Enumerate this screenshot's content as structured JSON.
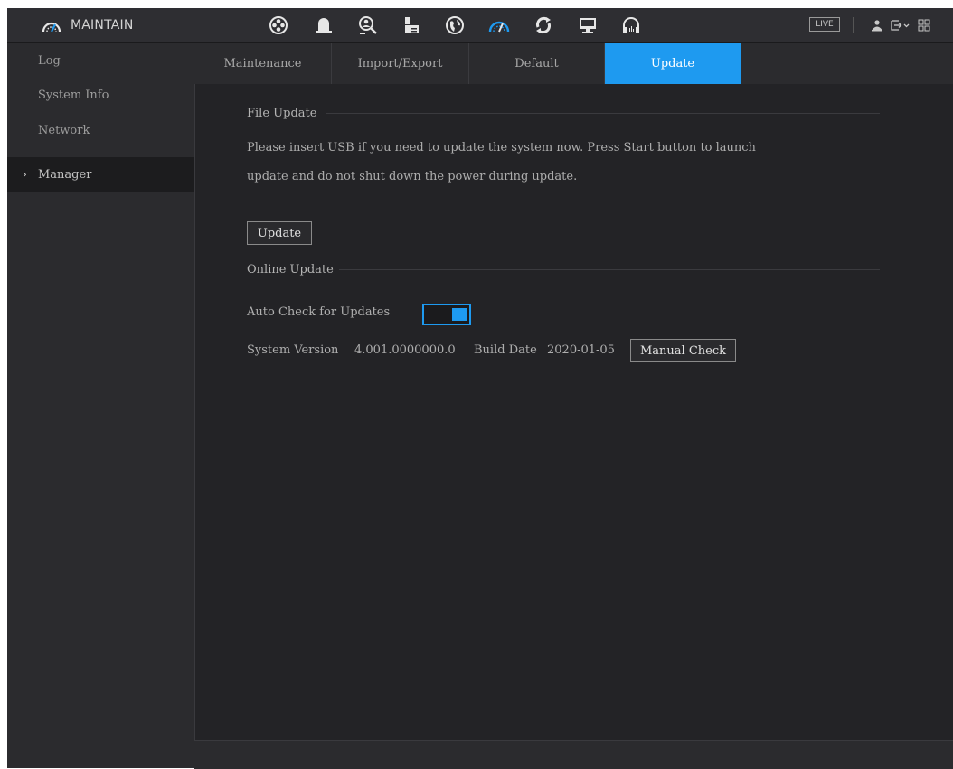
{
  "header": {
    "title": "MAINTAIN",
    "live_label": "LIVE",
    "icons": [
      "gauge-icon",
      "camera-reel-icon",
      "alarm-bell-icon",
      "search-person-icon",
      "storage-icon",
      "network-globe-icon",
      "maintain-gauge-icon",
      "backup-refresh-icon",
      "display-icon",
      "audio-headset-icon"
    ],
    "right_icons": [
      "user-icon",
      "logout-icon",
      "grid-menu-icon"
    ]
  },
  "sidebar": {
    "items": [
      {
        "label": "Log"
      },
      {
        "label": "System Info"
      },
      {
        "label": "Network"
      },
      {
        "label": "Manager",
        "chevron": "›"
      }
    ]
  },
  "tabs": [
    {
      "label": "Maintenance"
    },
    {
      "label": "Import/Export"
    },
    {
      "label": "Default"
    },
    {
      "label": "Update"
    }
  ],
  "file_update": {
    "heading": "File Update",
    "description_line1": "Please insert USB if you need to update the system now. Press Start button to launch",
    "description_line2": "update and do not shut down the power during update.",
    "update_button": "Update"
  },
  "online_update": {
    "heading": "Online Update",
    "auto_check_label": "Auto Check for Updates",
    "auto_check_enabled": true,
    "system_version_label": "System Version",
    "system_version_value": "4.001.0000000.0",
    "build_date_label": "Build Date",
    "build_date_value": "2020-01-05",
    "manual_check_button": "Manual Check"
  },
  "colors": {
    "accent": "#1e9af0",
    "background": "#232326",
    "panel": "#2b2b2e"
  }
}
